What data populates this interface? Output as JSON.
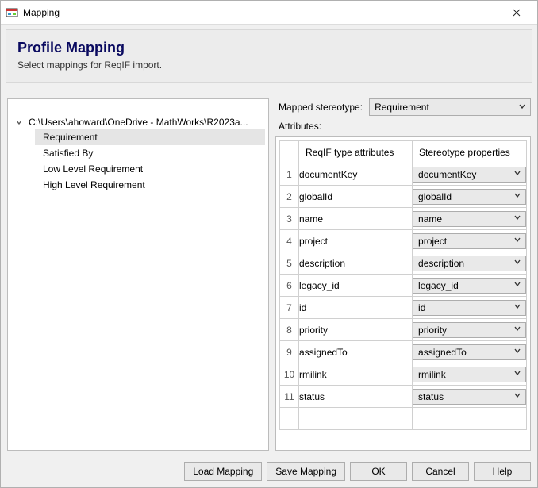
{
  "window": {
    "title": "Mapping"
  },
  "header": {
    "title": "Profile Mapping",
    "subtitle": "Select mappings for ReqIF import."
  },
  "tree": {
    "root": "C:\\Users\\ahoward\\OneDrive - MathWorks\\R2023a...",
    "items": [
      {
        "label": "Requirement",
        "selected": true
      },
      {
        "label": "Satisfied By",
        "selected": false
      },
      {
        "label": "Low Level Requirement",
        "selected": false
      },
      {
        "label": "High Level Requirement",
        "selected": false
      }
    ]
  },
  "mapped": {
    "label": "Mapped stereotype:",
    "value": "Requirement"
  },
  "attributes": {
    "label": "Attributes:",
    "col1": "ReqIF type attributes",
    "col2": "Stereotype properties",
    "rows": [
      {
        "n": "1",
        "type": "documentKey",
        "prop": "documentKey"
      },
      {
        "n": "2",
        "type": "globalId",
        "prop": "globalId"
      },
      {
        "n": "3",
        "type": "name",
        "prop": "name"
      },
      {
        "n": "4",
        "type": "project",
        "prop": "project"
      },
      {
        "n": "5",
        "type": "description",
        "prop": "description"
      },
      {
        "n": "6",
        "type": "legacy_id",
        "prop": "legacy_id"
      },
      {
        "n": "7",
        "type": "id",
        "prop": "id"
      },
      {
        "n": "8",
        "type": "priority",
        "prop": "priority"
      },
      {
        "n": "9",
        "type": "assignedTo",
        "prop": "assignedTo"
      },
      {
        "n": "10",
        "type": "rmilink",
        "prop": "rmilink"
      },
      {
        "n": "11",
        "type": "status",
        "prop": "status"
      }
    ]
  },
  "buttons": {
    "load": "Load Mapping",
    "save": "Save Mapping",
    "ok": "OK",
    "cancel": "Cancel",
    "help": "Help"
  }
}
